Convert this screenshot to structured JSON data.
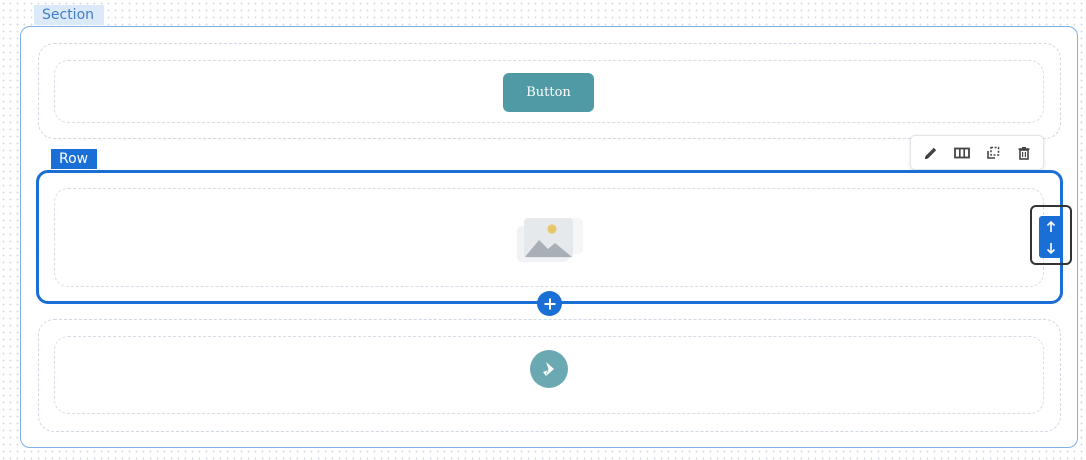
{
  "section": {
    "label": "Section"
  },
  "row": {
    "label": "Row"
  },
  "button_widget": {
    "label": "Button"
  },
  "toolbar": {
    "items": [
      {
        "name": "edit",
        "icon": "pencil-icon"
      },
      {
        "name": "columns",
        "icon": "columns-icon"
      },
      {
        "name": "duplicate",
        "icon": "duplicate-icon"
      },
      {
        "name": "delete",
        "icon": "trash-icon"
      }
    ]
  },
  "mover": {
    "up_icon": "arrow-up-icon",
    "down_icon": "arrow-down-icon"
  },
  "add_row": {
    "icon": "plus-icon"
  },
  "image_placeholder": {
    "icon": "image-placeholder-icon"
  },
  "brand_logo": {
    "icon": "brand-logo-icon"
  },
  "colors": {
    "accent": "#1a6fd6",
    "section_border": "#7fb0e6",
    "button_bg": "#4f9aa4",
    "logo_bg": "#6aa9b2"
  }
}
